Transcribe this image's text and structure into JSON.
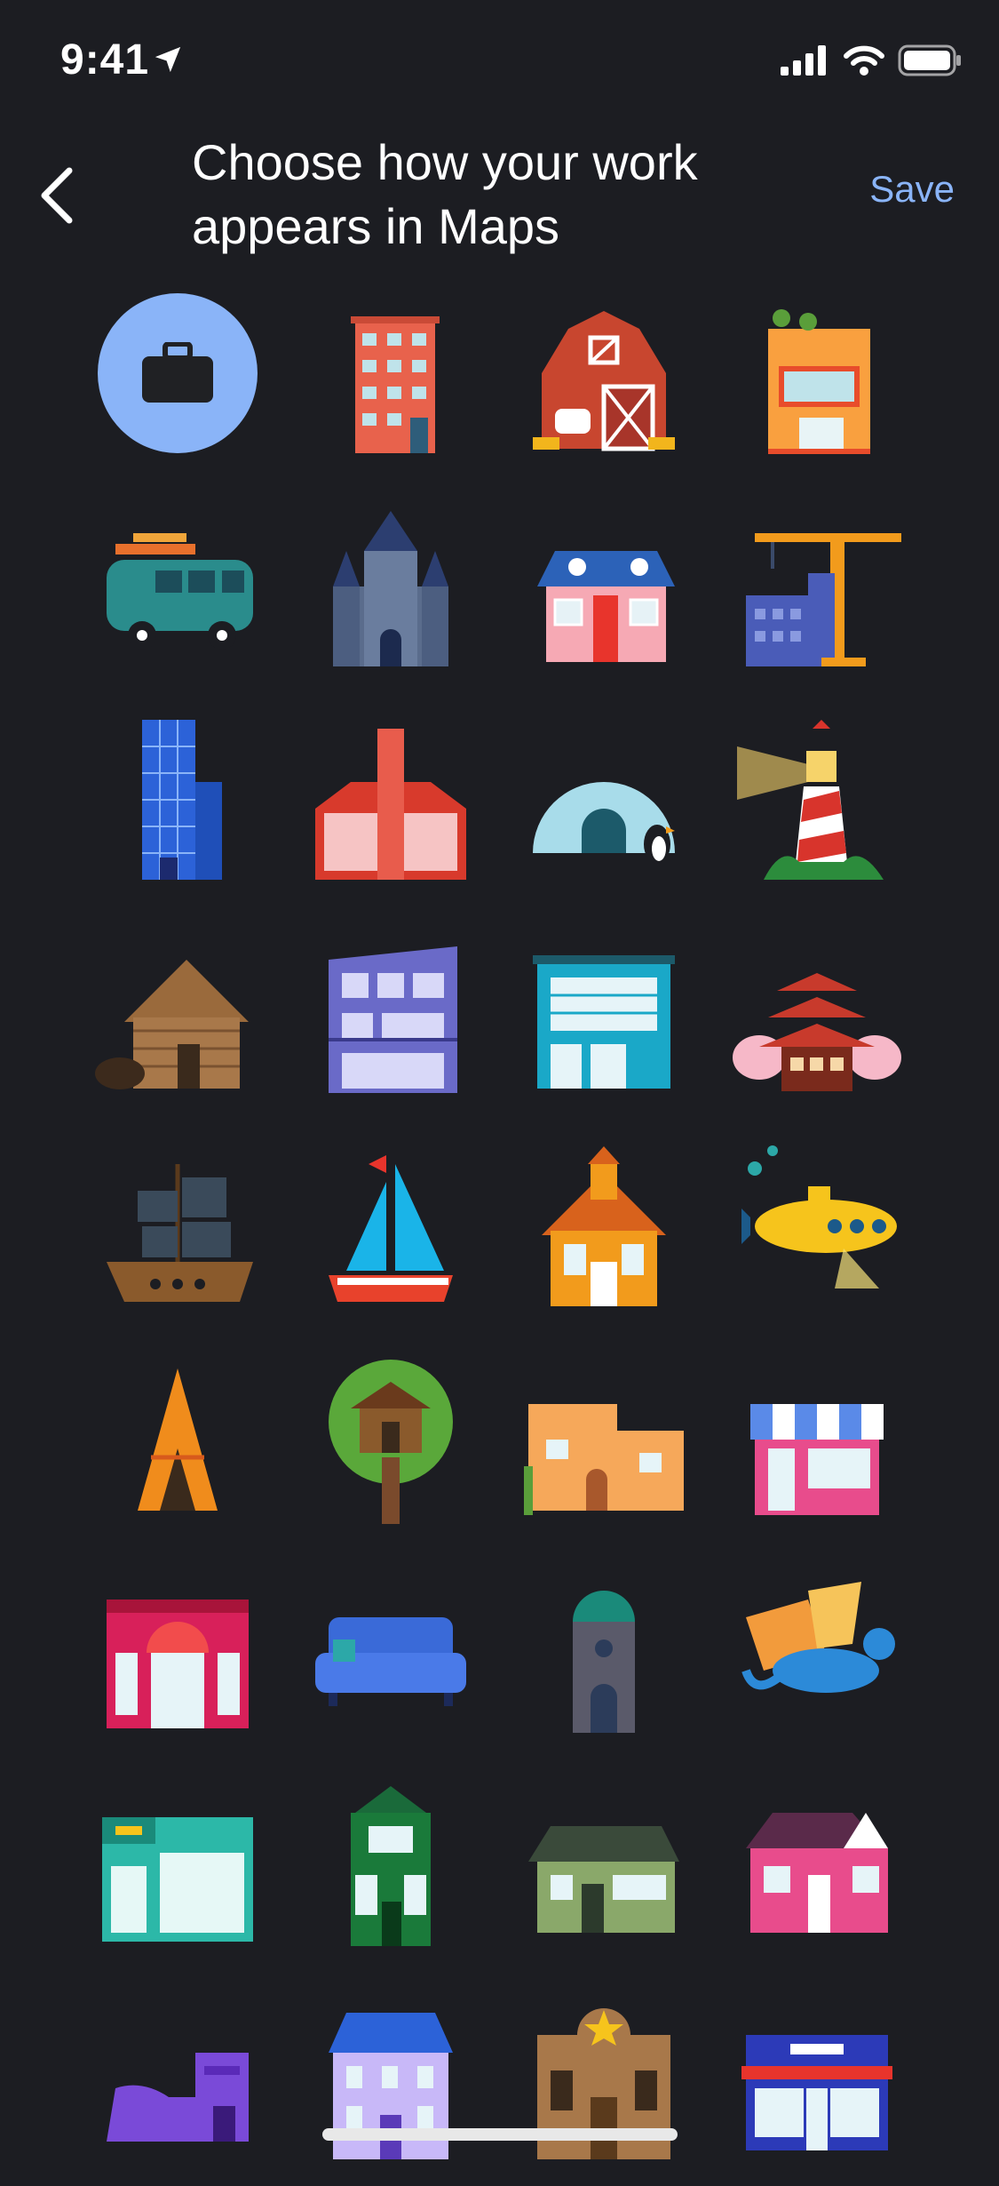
{
  "status": {
    "time": "9:41"
  },
  "header": {
    "title_line1": "Choose how your work",
    "title_line2": "appears in Maps",
    "save_label": "Save"
  },
  "colors": {
    "accent": "#8ab4f8",
    "background": "#1c1d22"
  },
  "icons": [
    "work-briefcase",
    "apartment-building",
    "barn",
    "rooftop-garden-shop",
    "camper-van",
    "castle",
    "cottage",
    "construction-crane",
    "office-tower",
    "glass-house",
    "igloo",
    "lighthouse",
    "log-cabin",
    "modern-house",
    "storefront-teal",
    "pagoda",
    "pirate-ship",
    "sailboat",
    "schoolhouse",
    "yellow-submarine",
    "teepee",
    "treehouse",
    "adobe-house",
    "ice-cream-shop",
    "red-storefront",
    "blue-sofa",
    "tower-dome",
    "dragon",
    "gym",
    "green-victorian-house",
    "green-bungalow",
    "pink-house",
    "shoe-house",
    "purple-mansion",
    "sheriff-office",
    "diner"
  ]
}
